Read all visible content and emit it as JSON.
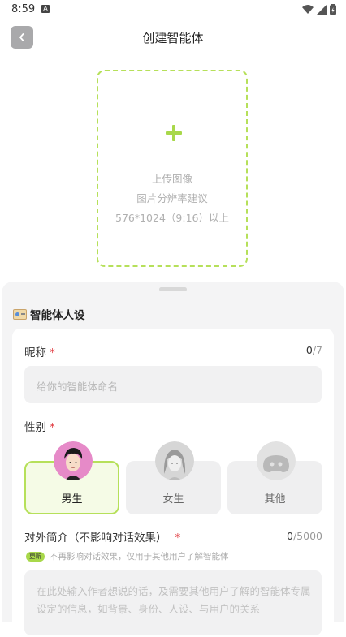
{
  "status_bar": {
    "time": "8:59",
    "notification_letter": "A"
  },
  "header": {
    "title": "创建智能体"
  },
  "upload": {
    "line1": "上传图像",
    "line2": "图片分辨率建议",
    "line3": "576*1024（9:16）以上"
  },
  "section": {
    "title": "智能体人设"
  },
  "nickname": {
    "label": "昵称",
    "required_mark": "*",
    "count_current": "0",
    "count_max": "/7",
    "placeholder": "给你的智能体命名"
  },
  "gender": {
    "label": "性别",
    "required_mark": "*",
    "options": [
      {
        "label": "男生",
        "selected": true
      },
      {
        "label": "女生",
        "selected": false
      },
      {
        "label": "其他",
        "selected": false
      }
    ]
  },
  "intro": {
    "label": "对外简介（不影响对话效果）",
    "required_mark": "*",
    "count_current": "0",
    "count_max": "/5000",
    "badge": "更新",
    "note": "不再影响对话效果，仅用于其他用户了解智能体",
    "placeholder": "在此处输入作者想说的话，及需要其他用户了解的智能体专属设定的信息，如背景、身份、人设、与用户的关系"
  },
  "colors": {
    "accent": "#a8d84a",
    "required": "#e0383e"
  }
}
